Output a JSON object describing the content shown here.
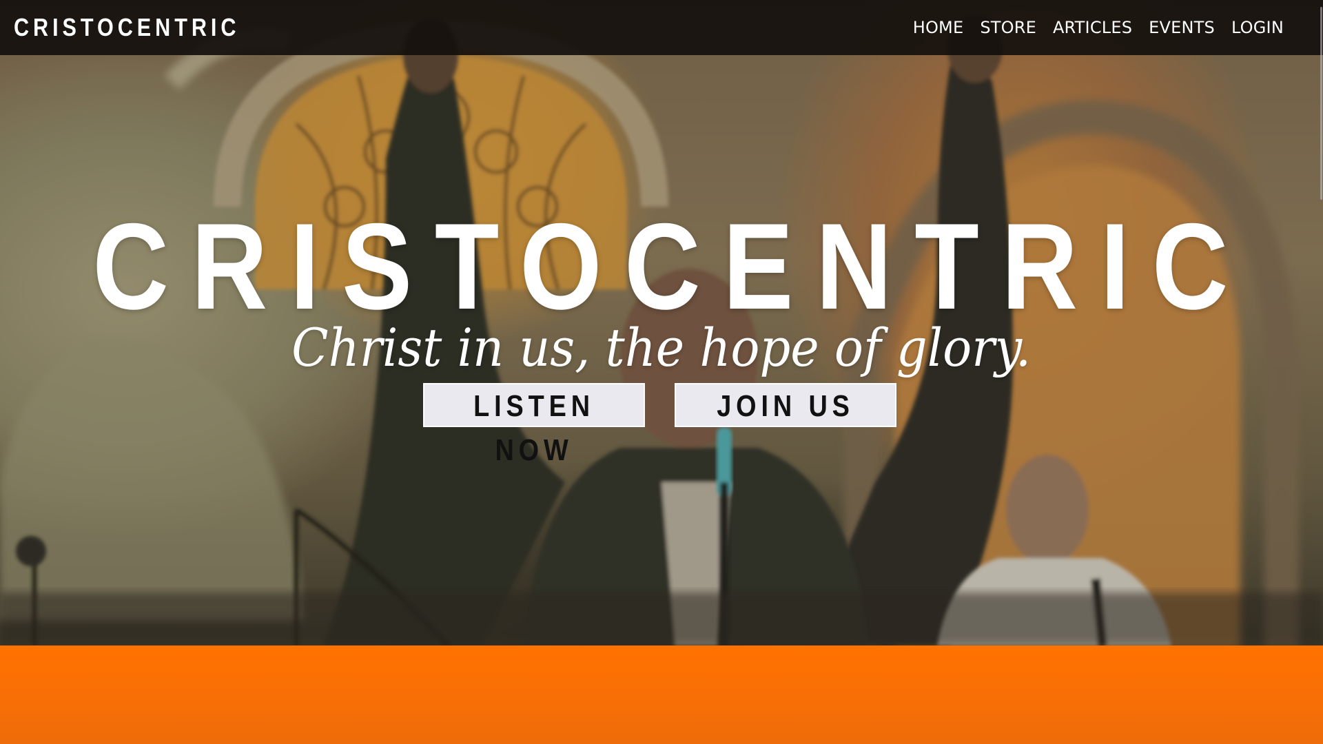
{
  "site": {
    "logo": "CRISTOCENTRIC"
  },
  "nav": {
    "items": [
      {
        "label": "HOME"
      },
      {
        "label": "STORE"
      },
      {
        "label": "ARTICLES"
      },
      {
        "label": "EVENTS"
      },
      {
        "label": "LOGIN"
      }
    ]
  },
  "hero": {
    "title": "CRISTOCENTRIC",
    "tagline": "Christ in us, the hope of glory.",
    "buttons": {
      "listen": "LISTEN NOW",
      "join": "JOIN US"
    }
  },
  "colors": {
    "navbar": "#14100e",
    "accent_orange": "#ff7200",
    "button_bg": "#e9e9ef",
    "text_white": "#ffffff"
  }
}
